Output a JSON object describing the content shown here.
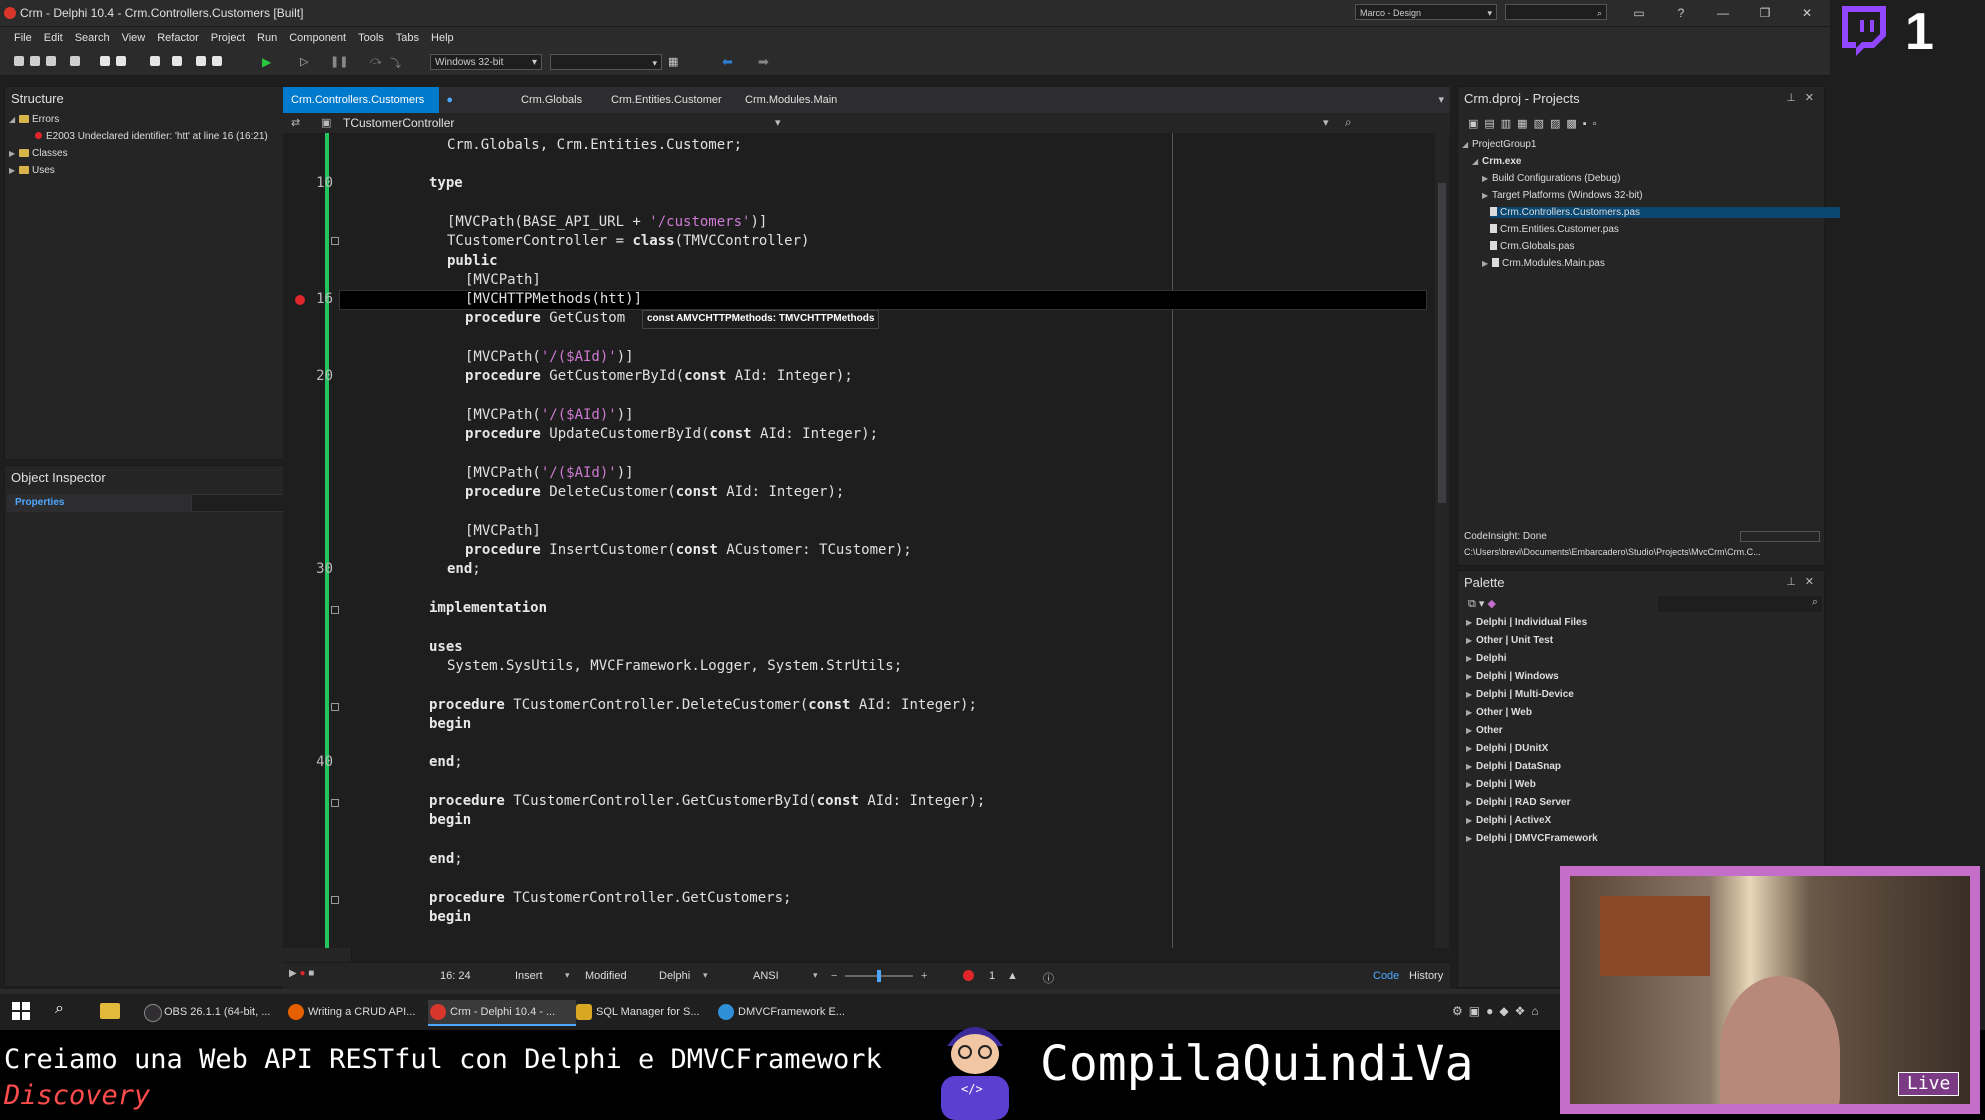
{
  "window": {
    "title": "Crm - Delphi 10.4 - Crm.Controllers.Customers [Built]",
    "layout_combo": "Marco - Design"
  },
  "menu": [
    "File",
    "Edit",
    "Search",
    "View",
    "Refactor",
    "Project",
    "Run",
    "Component",
    "Tools",
    "Tabs",
    "Help"
  ],
  "toolbar": {
    "platform": "Windows 32-bit"
  },
  "structure": {
    "title": "Structure",
    "errors_label": "Errors",
    "error_item": "E2003 Undeclared identifier: 'htt' at line 16 (16:21)",
    "classes_label": "Classes",
    "uses_label": "Uses"
  },
  "object_inspector": {
    "title": "Object Inspector",
    "tab_properties": "Properties"
  },
  "editor": {
    "tabs": [
      "Crm.Controllers.Customers",
      "Crm.Globals",
      "Crm.Entities.Customer",
      "Crm.Modules.Main"
    ],
    "nav_class": "TCustomerController",
    "tooltip": "const AMVCHTTPMethods: TMVCHTTPMethods"
  },
  "code": {
    "l1_a": "Crm.Globals, Crm.Entities.Customer;",
    "l10_kw": "type",
    "l12_a": "[MVCPath(BASE_API_URL + ",
    "l12_s": "'/customers'",
    "l12_b": ")]",
    "l13_a": "TCustomerController = ",
    "l13_kw": "class",
    "l13_b": "(TMVCController)",
    "l14_kw": "public",
    "l15": "[MVCPath]",
    "l16": "[MVCHTTPMethods(htt)]",
    "l17_kw": "procedure",
    "l17_a": " GetCustom",
    "l19_a": "[MVCPath(",
    "l19_s": "'/($AId)'",
    "l19_b": ")]",
    "l20_kw": "procedure",
    "l20_a": " GetCustomerById(",
    "l20_kw2": "const",
    "l20_b": " AId: Integer);",
    "l22_a": "[MVCPath(",
    "l22_s": "'/($AId)'",
    "l22_b": ")]",
    "l23_kw": "procedure",
    "l23_a": " UpdateCustomerById(",
    "l23_kw2": "const",
    "l23_b": " AId: Integer);",
    "l25_a": "[MVCPath(",
    "l25_s": "'/($AId)'",
    "l25_b": ")]",
    "l26_kw": "procedure",
    "l26_a": " DeleteCustomer(",
    "l26_kw2": "const",
    "l26_b": " AId: Integer);",
    "l28": "[MVCPath]",
    "l29_kw": "procedure",
    "l29_a": " InsertCustomer(",
    "l29_kw2": "const",
    "l29_b": " ACustomer: TCustomer);",
    "l30_kw": "end",
    "l30_b": ";",
    "l32_kw": "implementation",
    "l34_kw": "uses",
    "l35": "System.SysUtils, MVCFramework.Logger, System.StrUtils;",
    "l37_kw": "procedure",
    "l37_a": " TCustomerController.DeleteCustomer(",
    "l37_kw2": "const",
    "l37_b": " AId: Integer);",
    "l38_kw": "begin",
    "l40_kw": "end",
    "l40_b": ";",
    "l42_kw": "procedure",
    "l42_a": " TCustomerController.GetCustomerById(",
    "l42_kw2": "const",
    "l42_b": " AId: Integer);",
    "l43_kw": "begin",
    "l45_kw": "end",
    "l45_b": ";",
    "l47_kw": "procedure",
    "l47_a": " TCustomerController.GetCustomers;",
    "l48_kw": "begin",
    "n10": "10",
    "n16": "16",
    "n20": "20",
    "n30": "30",
    "n40": "40"
  },
  "statusbar": {
    "position": "16: 24",
    "mode": "Insert",
    "state": "Modified",
    "language": "Delphi",
    "encoding": "ANSI",
    "errors": "1",
    "tab_code": "Code",
    "tab_history": "History"
  },
  "projects": {
    "title": "Crm.dproj - Projects",
    "group": "ProjectGroup1",
    "exe": "Crm.exe",
    "items": [
      "Build Configurations (Debug)",
      "Target Platforms (Windows 32-bit)",
      "Crm.Controllers.Customers.pas",
      "Crm.Entities.Customer.pas",
      "Crm.Globals.pas",
      "Crm.Modules.Main.pas"
    ],
    "status": "CodeInsight: Done",
    "path": "C:\\Users\\brevi\\Documents\\Embarcadero\\Studio\\Projects\\MvcCrm\\Crm.C..."
  },
  "palette": {
    "title": "Palette",
    "items": [
      "Delphi | Individual Files",
      "Other | Unit Test",
      "Delphi",
      "Delphi | Windows",
      "Delphi | Multi-Device",
      "Other | Web",
      "Other",
      "Delphi | DUnitX",
      "Delphi | DataSnap",
      "Delphi | Web",
      "Delphi | RAD Server",
      "Delphi | ActiveX",
      "Delphi | DMVCFramework"
    ]
  },
  "taskbar": {
    "items": [
      "OBS 26.1.1 (64-bit, ...",
      "Writing a CRUD API...",
      "Crm - Delphi 10.4 - ...",
      "SQL Manager for S...",
      "DMVCFramework E..."
    ]
  },
  "stream": {
    "viewer_count": "1",
    "caption": "Creiamo una Web API RESTful con Delphi e DMVCFramework",
    "category": "Discovery",
    "channel": "CompilaQuindiVa",
    "live_badge": "Live",
    "logo_glyph": "</>"
  },
  "colors": {
    "accent": "#007acc",
    "twitch_purple": "#9146ff",
    "cam_border": "#c46ec9",
    "modified_bar": "#22c55e",
    "error_red": "#e0262b"
  }
}
